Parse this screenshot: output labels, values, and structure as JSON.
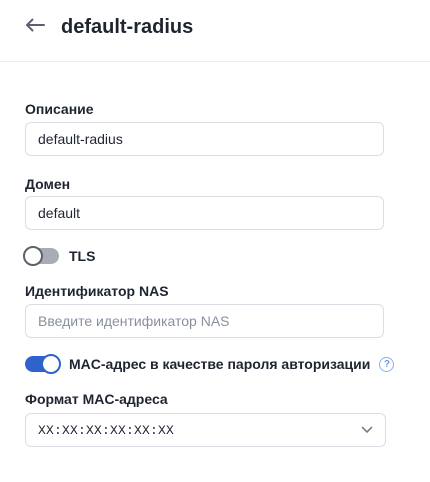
{
  "header": {
    "title": "default-radius"
  },
  "fields": {
    "description": {
      "label": "Описание",
      "value": "default-radius"
    },
    "domain": {
      "label": "Домен",
      "value": "default"
    },
    "nas_id": {
      "label": "Идентификатор NAS",
      "value": "",
      "placeholder": "Введите идентификатор NAS"
    },
    "mac_format": {
      "label": "Формат MAC-адреса",
      "selected": "XX:XX:XX:XX:XX:XX"
    }
  },
  "toggles": {
    "tls": {
      "label": "TLS",
      "state": "off"
    },
    "mac_password": {
      "label": "MAC-адрес в качестве пароля авторизации",
      "state": "on",
      "help_icon": "?"
    }
  },
  "colors": {
    "accent": "#2f63cc",
    "toggle_off": "#a7acb5",
    "text": "#1f2530",
    "border": "#dadde3",
    "help_icon": "#6f9be3"
  }
}
